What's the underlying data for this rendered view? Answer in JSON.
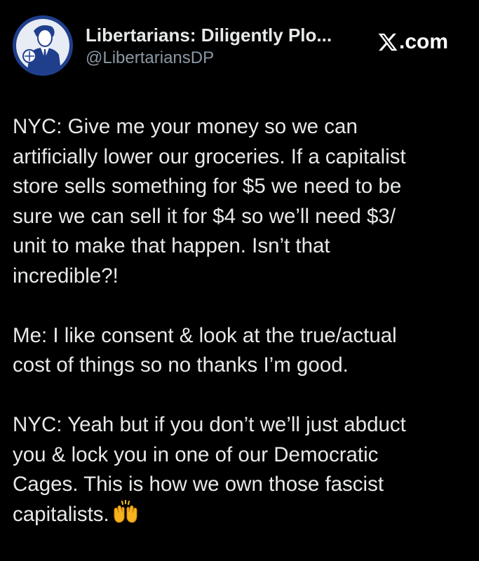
{
  "tweet": {
    "display_name": "Libertarians: Diligently Plo...",
    "handle": "@LibertariansDP",
    "site": ".com",
    "avatar_icon": "vintage-man-avatar-icon",
    "paragraphs": [
      {
        "lines": [
          "NYC: Give me your money so we can",
          "artificially lower our groceries. If a capitalist",
          "store sells something for $5 we need to be",
          "sure we can sell it for $4 so we’ll need $3/",
          "unit to make that happen. Isn’t that",
          "incredible?!"
        ]
      },
      {
        "lines": [
          "Me: I like consent & look at the true/actual",
          "cost of things so no thanks I’m good."
        ]
      },
      {
        "lines": [
          "NYC: Yeah but if you don’t we’ll just abduct",
          "you & lock you in one of our Democratic",
          "Cages. This is how we own those fascist",
          "capitalists."
        ],
        "trailing_icon": "raised-hands-emoji-icon"
      }
    ]
  },
  "colors": {
    "background": "#000000",
    "text": "#e7e9ea",
    "handle": "#8b98a5",
    "avatar_bg": "#1f3f8c"
  }
}
